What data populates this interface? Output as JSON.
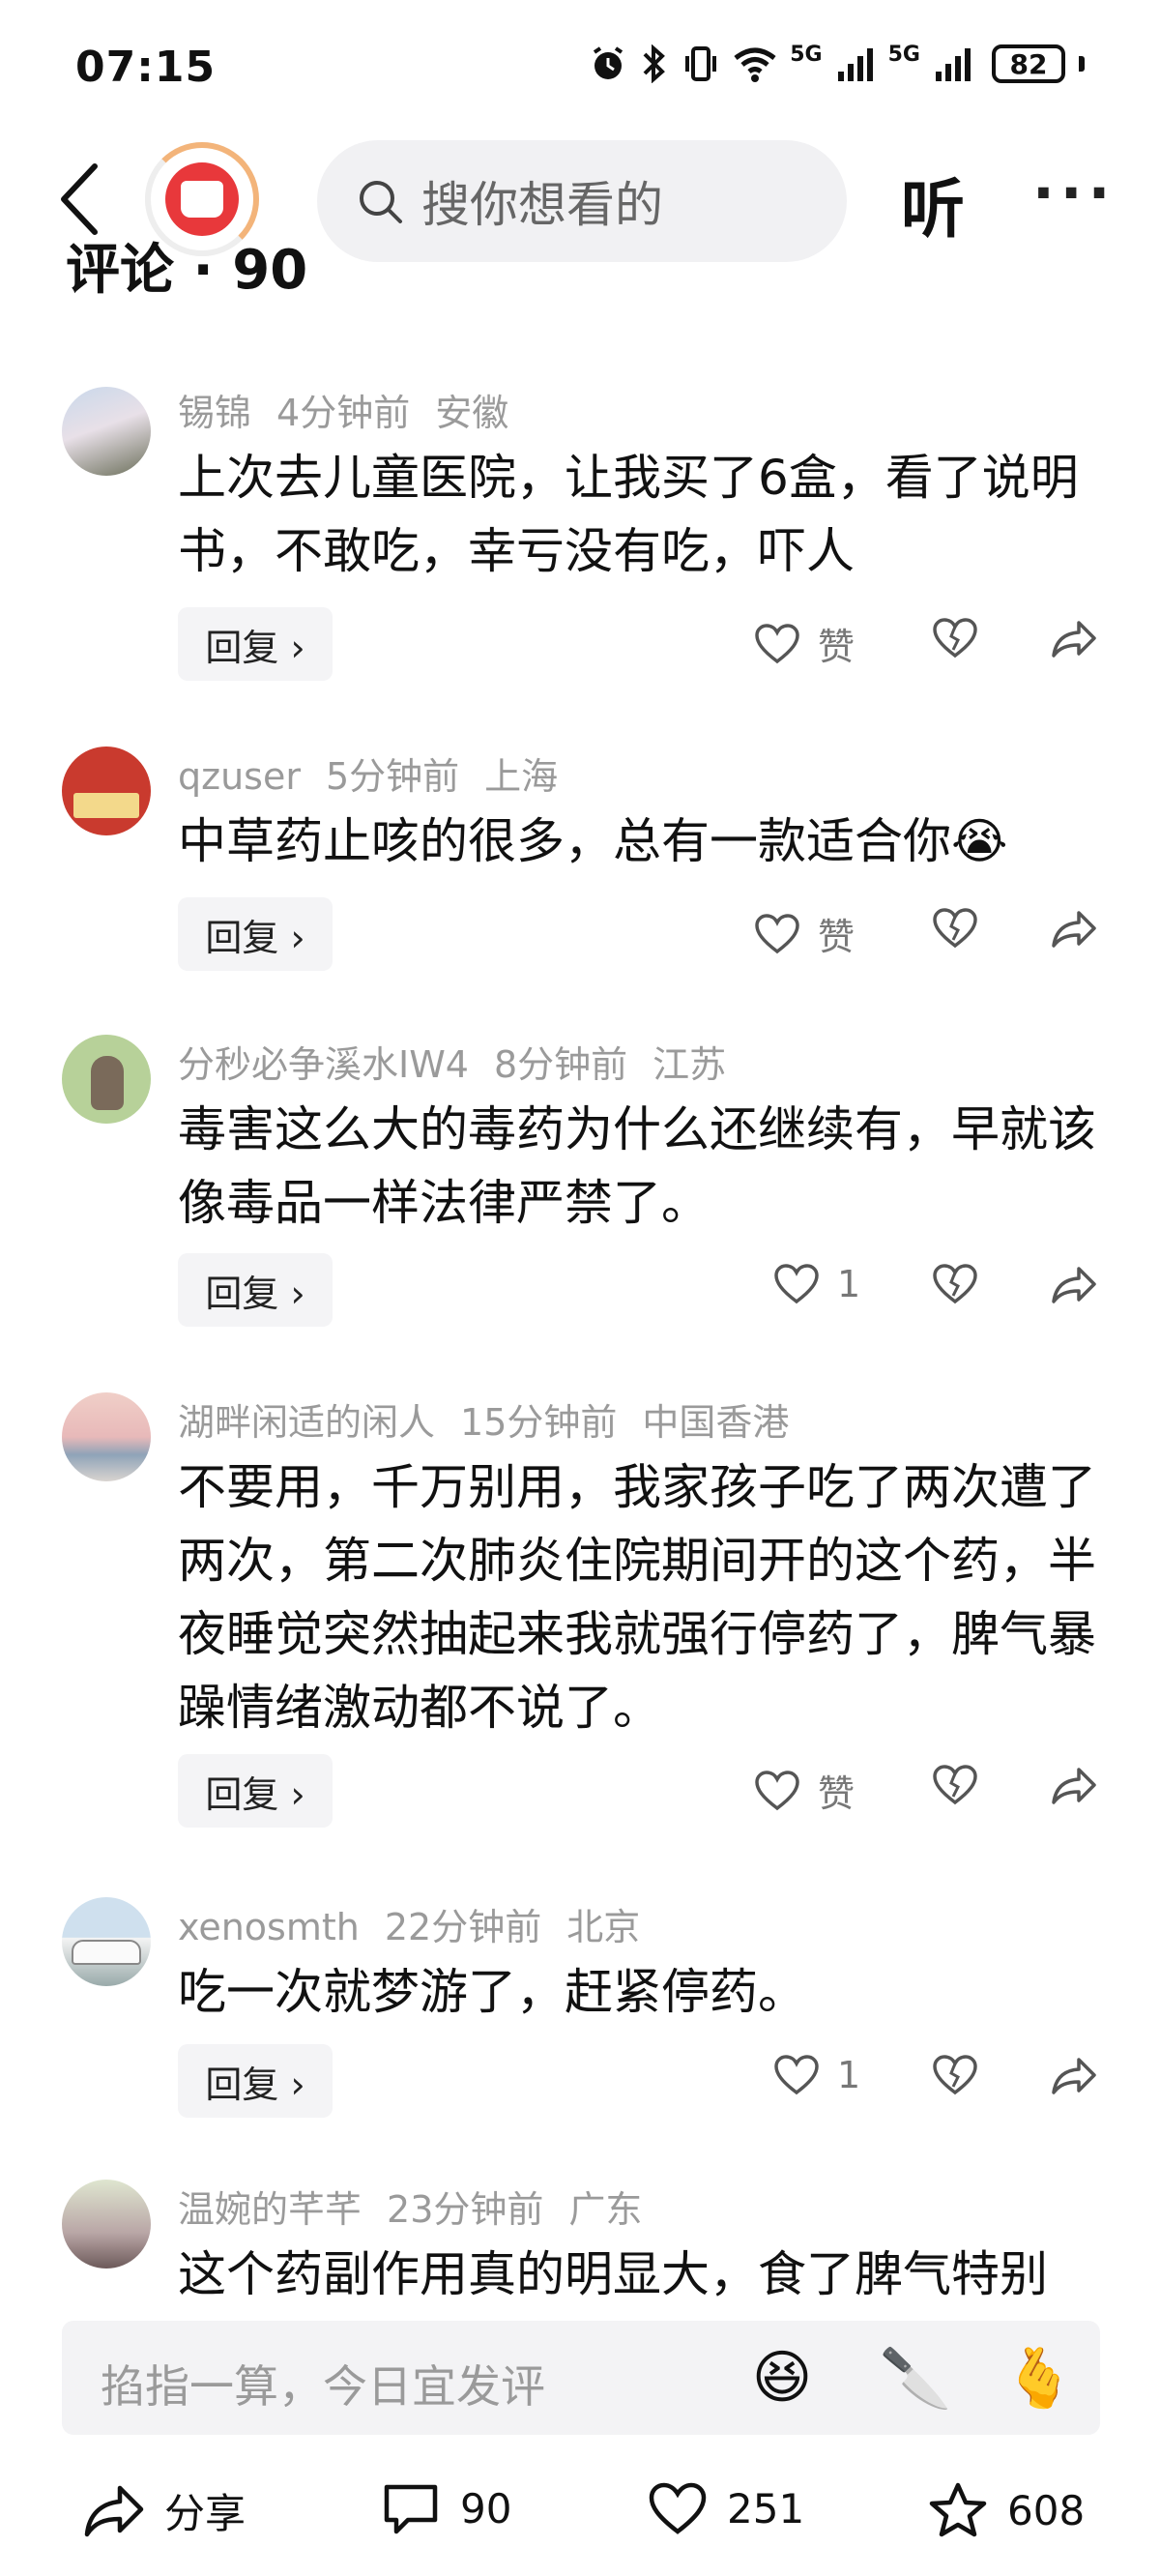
{
  "status_bar": {
    "time": "07:15",
    "network_1": "5G",
    "network_2": "5G",
    "battery": "82"
  },
  "header": {
    "search_placeholder": "搜你想看的",
    "listen_label": "听",
    "more_label": "···"
  },
  "comments_header": {
    "label": "评论 · 90"
  },
  "comments": [
    {
      "user": "锡锦",
      "time": "4分钟前",
      "location": "安徽",
      "text": "上次去儿童医院，让我买了6盒，看了说明书，不敢吃，幸亏没有吃，吓人",
      "reply_label": "回复 ›",
      "likes": "赞"
    },
    {
      "user": "qzuser",
      "time": "5分钟前",
      "location": "上海",
      "text": "中草药止咳的很多，总有一款适合你😭",
      "reply_label": "回复 ›",
      "likes": "赞"
    },
    {
      "user": "分秒必争溪水IW4",
      "time": "8分钟前",
      "location": "江苏",
      "text": "毒害这么大的毒药为什么还继续有，早就该像毒品一样法律严禁了。",
      "reply_label": "回复 ›",
      "likes": "1"
    },
    {
      "user": "湖畔闲适的闲人",
      "time": "15分钟前",
      "location": "中国香港",
      "text": "不要用，千万别用，我家孩子吃了两次遭了两次，第二次肺炎住院期间开的这个药，半夜睡觉突然抽起来我就强行停药了，脾气暴躁情绪激动都不说了。",
      "reply_label": "回复 ›",
      "likes": "赞"
    },
    {
      "user": "xenosmth",
      "time": "22分钟前",
      "location": "北京",
      "text": "吃一次就梦游了，赶紧停药。",
      "reply_label": "回复 ›",
      "likes": "1"
    },
    {
      "user": "温婉的芊芊",
      "time": "23分钟前",
      "location": "广东",
      "text": "这个药副作用真的明显大，食了脾气特别",
      "reply_label": "",
      "likes": ""
    }
  ],
  "input_bar": {
    "placeholder": "掐指一算，今日宜发评",
    "emoji_1": "😆",
    "emoji_2": "🔪",
    "emoji_3": "🫰"
  },
  "bottom_bar": {
    "share_label": "分享",
    "comments_count": "90",
    "likes_count": "251",
    "favorites_count": "608"
  },
  "colors": {
    "meta_gray": "#9a9a9a",
    "logo_red": "#e8383b",
    "search_bg": "#f1f1f3"
  }
}
